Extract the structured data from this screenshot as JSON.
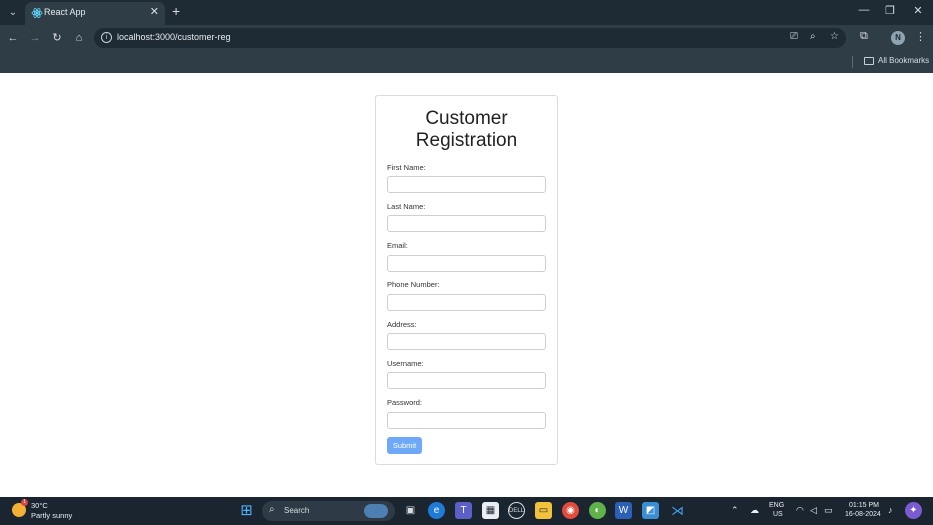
{
  "browser": {
    "tab_title": "React App",
    "url": "localhost:3000/customer-reg",
    "profile_initial": "N",
    "bookmarks_label": "All Bookmarks"
  },
  "form": {
    "title_line1": "Customer",
    "title_line2": "Registration",
    "fields": [
      {
        "label": "First Name:",
        "value": ""
      },
      {
        "label": "Last Name:",
        "value": ""
      },
      {
        "label": "Email:",
        "value": ""
      },
      {
        "label": "Phone Number:",
        "value": ""
      },
      {
        "label": "Address:",
        "value": ""
      },
      {
        "label": "Username:",
        "value": ""
      },
      {
        "label": "Password:",
        "value": ""
      }
    ],
    "submit_label": "Submit"
  },
  "taskbar": {
    "weather_temp": "30°C",
    "weather_desc": "Partly sunny",
    "weather_badge": "1",
    "search_label": "Search",
    "lang_line1": "ENG",
    "lang_line2": "US",
    "time": "01:15 PM",
    "date": "16-08-2024"
  },
  "colors": {
    "submit_bg": "#6ea8f7",
    "chrome_bg": "#2f3d47",
    "taskbar_bg": "#1b2530"
  }
}
